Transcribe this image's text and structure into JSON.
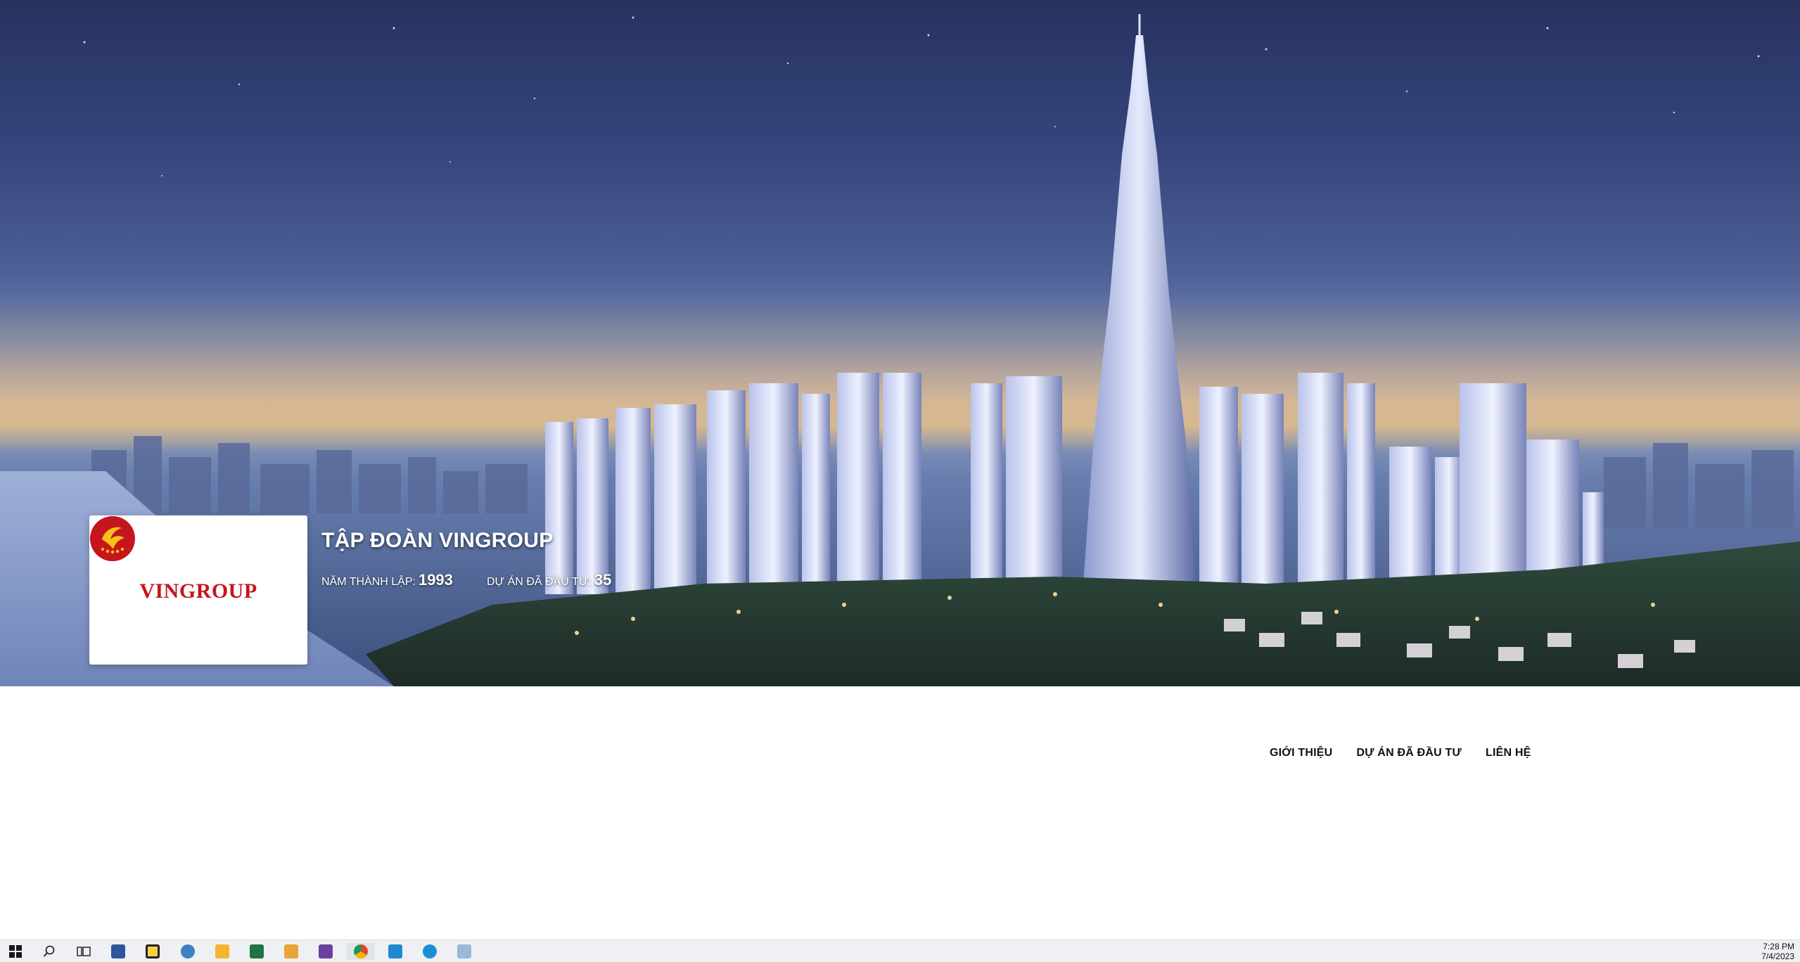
{
  "company": {
    "name": "TẬP ĐOÀN VINGROUP",
    "logo_text": "VINGROUP",
    "founded_label": "NĂM THÀNH LẬP:",
    "founded_value": "1993",
    "projects_label": "DỰ ÁN ĐÃ ĐẦU TƯ:",
    "projects_value": "35"
  },
  "nav": {
    "items": [
      "GIỚI THIỆU",
      "DỰ ÁN ĐÃ ĐẦU TƯ",
      "LIÊN HỆ"
    ]
  },
  "taskbar": {
    "icons": [
      "windows-start-icon",
      "search-icon",
      "task-view-icon",
      "word-icon",
      "sticky-notes-icon",
      "chrome-notification-icon",
      "file-explorer-icon",
      "excel-icon",
      "snipping-tool-icon",
      "visual-studio-icon",
      "chrome-icon",
      "vscode-icon",
      "edge-icon",
      "paint-icon"
    ],
    "time": "7:28 PM",
    "date": "7/4/2023"
  },
  "colors": {
    "brand_red": "#c4161c",
    "brand_gold": "#f6c21a"
  }
}
